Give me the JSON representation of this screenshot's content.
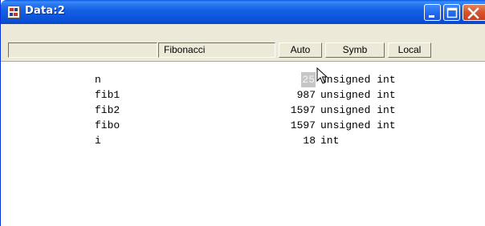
{
  "window": {
    "title": "Data:2",
    "controls": [
      "minimize",
      "maximize",
      "close"
    ]
  },
  "header": {
    "expression": "",
    "function": "Fibonacci",
    "buttons": {
      "auto": "Auto",
      "symb": "Symb",
      "local": "Local"
    }
  },
  "variables": [
    {
      "name": "n",
      "value": "25",
      "type": "unsigned int",
      "selected": true
    },
    {
      "name": "fib1",
      "value": "987",
      "type": "unsigned int",
      "selected": false
    },
    {
      "name": "fib2",
      "value": "1597",
      "type": "unsigned int",
      "selected": false
    },
    {
      "name": "fibo",
      "value": "1597",
      "type": "unsigned int",
      "selected": false
    },
    {
      "name": "i",
      "value": "18",
      "type": "int",
      "selected": false
    }
  ],
  "colors": {
    "titlebar": "#0a4fd5",
    "close_button": "#d9532a",
    "selection_bg": "#c6c6c6"
  }
}
